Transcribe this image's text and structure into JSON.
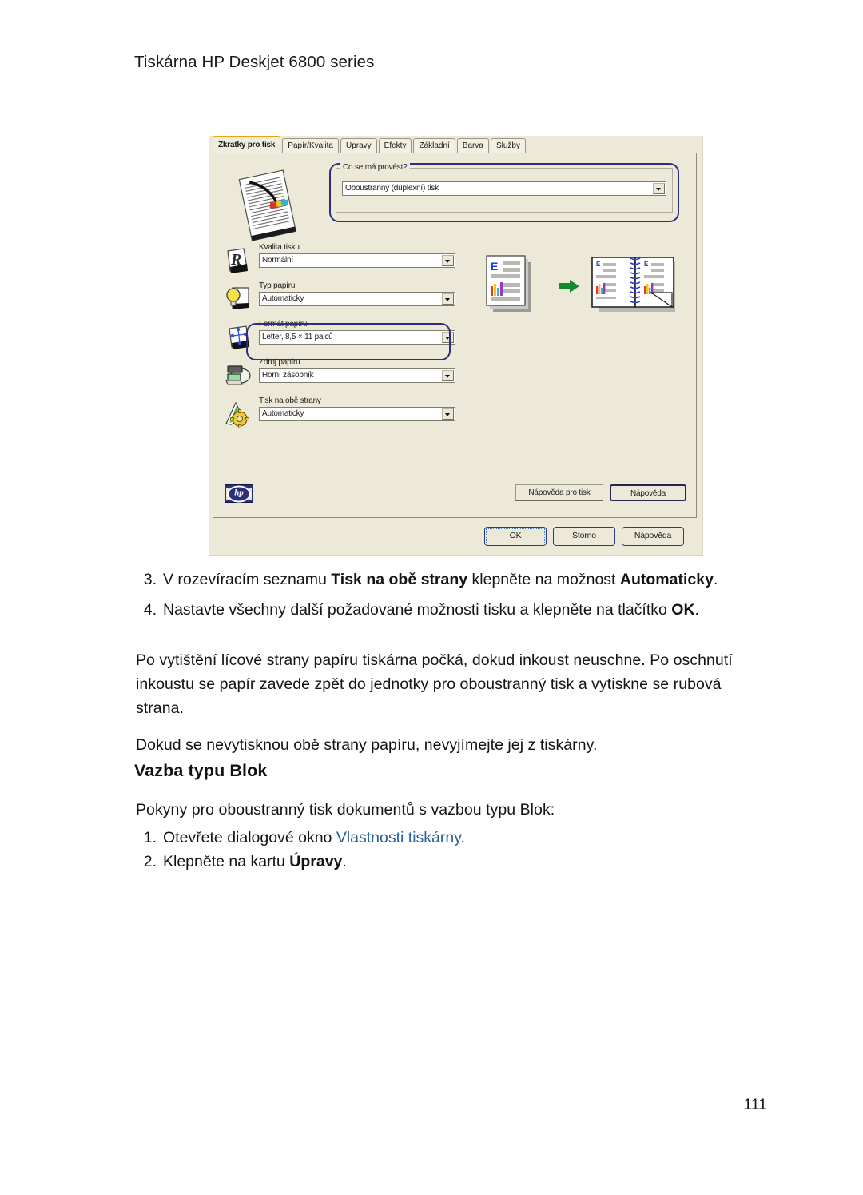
{
  "page": {
    "header": "Tiskárna HP Deskjet 6800 series",
    "number": "111"
  },
  "dialog": {
    "tabs": [
      {
        "label": "Zkratky pro tisk",
        "active": true
      },
      {
        "label": "Papír/Kvalita",
        "active": false
      },
      {
        "label": "Úpravy",
        "active": false
      },
      {
        "label": "Efekty",
        "active": false
      },
      {
        "label": "Základní",
        "active": false
      },
      {
        "label": "Barva",
        "active": false
      },
      {
        "label": "Služby",
        "active": false
      }
    ],
    "action_group": {
      "title": "Co se má provést?",
      "value": "Oboustranný (duplexní) tisk"
    },
    "settings": [
      {
        "label": "Kvalita tisku",
        "value": "Normální",
        "icon": "print-quality-icon"
      },
      {
        "label": "Typ papíru",
        "value": "Automaticky",
        "icon": "paper-type-icon"
      },
      {
        "label": "Formát papíru",
        "value": "Letter, 8,5 × 11 palců",
        "icon": "paper-size-icon"
      },
      {
        "label": "Zdroj papíru",
        "value": "Horní zásobník",
        "icon": "paper-source-icon"
      },
      {
        "label": "Tisk na obě strany",
        "value": "Automaticky",
        "icon": "two-sided-icon"
      }
    ],
    "panel_buttons": {
      "help_print": "Nápověda pro tisk",
      "help": "Nápověda"
    },
    "dialog_buttons": {
      "ok": "OK",
      "cancel": "Storno",
      "help": "Nápověda"
    },
    "logo_text": "hp",
    "colors": {
      "highlight_border": "#2e2f7a",
      "active_tab_top": "#e8a317",
      "dialog_face": "#ece9d8",
      "arrow_green": "#128a2a"
    }
  },
  "content": {
    "step3": {
      "num": "3.",
      "part1": "V rozevíracím seznamu ",
      "bold1": "Tisk na obě strany",
      "part2": " klepněte na možnost ",
      "bold2": "Automaticky",
      "part3": "."
    },
    "step4": {
      "num": "4.",
      "part1": "Nastavte všechny další požadované možnosti tisku a klepněte na tlačítko ",
      "bold1": "OK",
      "part2": "."
    },
    "para1": "Po vytištění lícové strany papíru tiskárna počká, dokud inkoust neuschne. Po oschnutí inkoustu se papír zavede zpět do jednotky pro oboustranný tisk a vytiskne se rubová strana.",
    "para2": "Dokud se nevytisknou obě strany papíru, nevyjímejte jej z tiskárny.",
    "heading": "Vazba typu Blok",
    "intro": "Pokyny pro oboustranný tisk dokumentů s vazbou typu Blok:",
    "step1": {
      "num": "1.",
      "part1": "Otevřete dialogové okno ",
      "link": "Vlastnosti tiskárny",
      "part2": "."
    },
    "step2": {
      "num": "2.",
      "part1": "Klepněte na kartu ",
      "bold1": "Úpravy",
      "part2": "."
    }
  }
}
